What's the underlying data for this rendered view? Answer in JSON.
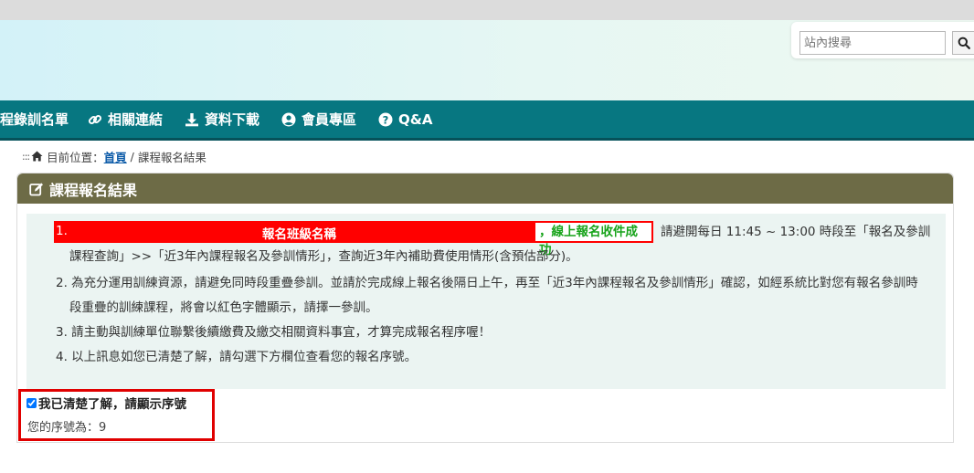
{
  "search": {
    "placeholder": "站內搜尋",
    "button_icon": "search-icon"
  },
  "nav": {
    "items": [
      {
        "label": "程錄訓名單",
        "icon": ""
      },
      {
        "label": "相關連結",
        "icon": "link-icon"
      },
      {
        "label": "資料下載",
        "icon": "download-icon"
      },
      {
        "label": "會員專區",
        "icon": "user-circle-icon"
      },
      {
        "label": "Q&A",
        "icon": "question-circle-icon"
      }
    ],
    "bg_color": "#077781"
  },
  "breadcrumb": {
    "dots": ":::",
    "prefix": "目前位置：",
    "home": "首頁",
    "separator": " / ",
    "current": "課程報名結果"
  },
  "panel": {
    "title": "課程報名結果",
    "header_color": "#6d6b46"
  },
  "notice": {
    "item1": {
      "number": "1.",
      "class_name": "報名班級名稱",
      "success": "，線上報名收件成功",
      "text_a": "請避開每日 11:45 ~ 13:00 時段至「報名及參訓",
      "text_b": "課程查詢」>>「近3年內課程報名及參訓情形」，查詢近3年內補助費使用情形(含預估部分)。"
    },
    "item2": {
      "line1": "2. 為充分運用訓練資源，請避免同時段重疊參訓。並請於完成線上報名後隔日上午，再至「近3年內課程報名及參訓情形」確認，如經系統比對您有報名參訓時",
      "line2": "段重疊的訓練課程，將會以紅色字體顯示，請擇一參訓。"
    },
    "item3": "3. 請主動與訓練單位聯繫後續繳費及繳交相關資料事宜，才算完成報名程序喔！",
    "item4": "4. 以上訊息如您已清楚了解，請勾選下方欄位查看您的報名序號。"
  },
  "confirm": {
    "checkbox_label": "我已清楚了解，請顯示序號",
    "checked": true,
    "sequence_label": "您的序號為：9"
  },
  "colors": {
    "highlight_red": "#ff0000",
    "success_green": "#17a31a"
  }
}
